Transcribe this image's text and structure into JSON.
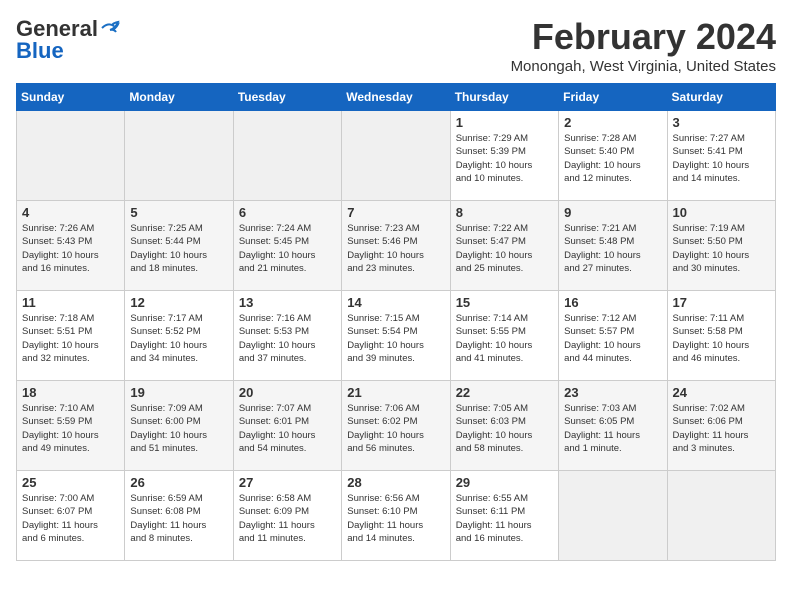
{
  "logo": {
    "name_general": "General",
    "name_blue": "Blue"
  },
  "header": {
    "month_year": "February 2024",
    "location": "Monongah, West Virginia, United States"
  },
  "days_of_week": [
    "Sunday",
    "Monday",
    "Tuesday",
    "Wednesday",
    "Thursday",
    "Friday",
    "Saturday"
  ],
  "weeks": [
    {
      "row_class": "row-white",
      "days": [
        {
          "num": "",
          "empty": true,
          "info": ""
        },
        {
          "num": "",
          "empty": true,
          "info": ""
        },
        {
          "num": "",
          "empty": true,
          "info": ""
        },
        {
          "num": "",
          "empty": true,
          "info": ""
        },
        {
          "num": "1",
          "empty": false,
          "info": "Sunrise: 7:29 AM\nSunset: 5:39 PM\nDaylight: 10 hours\nand 10 minutes."
        },
        {
          "num": "2",
          "empty": false,
          "info": "Sunrise: 7:28 AM\nSunset: 5:40 PM\nDaylight: 10 hours\nand 12 minutes."
        },
        {
          "num": "3",
          "empty": false,
          "info": "Sunrise: 7:27 AM\nSunset: 5:41 PM\nDaylight: 10 hours\nand 14 minutes."
        }
      ]
    },
    {
      "row_class": "row-gray",
      "days": [
        {
          "num": "4",
          "empty": false,
          "info": "Sunrise: 7:26 AM\nSunset: 5:43 PM\nDaylight: 10 hours\nand 16 minutes."
        },
        {
          "num": "5",
          "empty": false,
          "info": "Sunrise: 7:25 AM\nSunset: 5:44 PM\nDaylight: 10 hours\nand 18 minutes."
        },
        {
          "num": "6",
          "empty": false,
          "info": "Sunrise: 7:24 AM\nSunset: 5:45 PM\nDaylight: 10 hours\nand 21 minutes."
        },
        {
          "num": "7",
          "empty": false,
          "info": "Sunrise: 7:23 AM\nSunset: 5:46 PM\nDaylight: 10 hours\nand 23 minutes."
        },
        {
          "num": "8",
          "empty": false,
          "info": "Sunrise: 7:22 AM\nSunset: 5:47 PM\nDaylight: 10 hours\nand 25 minutes."
        },
        {
          "num": "9",
          "empty": false,
          "info": "Sunrise: 7:21 AM\nSunset: 5:48 PM\nDaylight: 10 hours\nand 27 minutes."
        },
        {
          "num": "10",
          "empty": false,
          "info": "Sunrise: 7:19 AM\nSunset: 5:50 PM\nDaylight: 10 hours\nand 30 minutes."
        }
      ]
    },
    {
      "row_class": "row-white",
      "days": [
        {
          "num": "11",
          "empty": false,
          "info": "Sunrise: 7:18 AM\nSunset: 5:51 PM\nDaylight: 10 hours\nand 32 minutes."
        },
        {
          "num": "12",
          "empty": false,
          "info": "Sunrise: 7:17 AM\nSunset: 5:52 PM\nDaylight: 10 hours\nand 34 minutes."
        },
        {
          "num": "13",
          "empty": false,
          "info": "Sunrise: 7:16 AM\nSunset: 5:53 PM\nDaylight: 10 hours\nand 37 minutes."
        },
        {
          "num": "14",
          "empty": false,
          "info": "Sunrise: 7:15 AM\nSunset: 5:54 PM\nDaylight: 10 hours\nand 39 minutes."
        },
        {
          "num": "15",
          "empty": false,
          "info": "Sunrise: 7:14 AM\nSunset: 5:55 PM\nDaylight: 10 hours\nand 41 minutes."
        },
        {
          "num": "16",
          "empty": false,
          "info": "Sunrise: 7:12 AM\nSunset: 5:57 PM\nDaylight: 10 hours\nand 44 minutes."
        },
        {
          "num": "17",
          "empty": false,
          "info": "Sunrise: 7:11 AM\nSunset: 5:58 PM\nDaylight: 10 hours\nand 46 minutes."
        }
      ]
    },
    {
      "row_class": "row-gray",
      "days": [
        {
          "num": "18",
          "empty": false,
          "info": "Sunrise: 7:10 AM\nSunset: 5:59 PM\nDaylight: 10 hours\nand 49 minutes."
        },
        {
          "num": "19",
          "empty": false,
          "info": "Sunrise: 7:09 AM\nSunset: 6:00 PM\nDaylight: 10 hours\nand 51 minutes."
        },
        {
          "num": "20",
          "empty": false,
          "info": "Sunrise: 7:07 AM\nSunset: 6:01 PM\nDaylight: 10 hours\nand 54 minutes."
        },
        {
          "num": "21",
          "empty": false,
          "info": "Sunrise: 7:06 AM\nSunset: 6:02 PM\nDaylight: 10 hours\nand 56 minutes."
        },
        {
          "num": "22",
          "empty": false,
          "info": "Sunrise: 7:05 AM\nSunset: 6:03 PM\nDaylight: 10 hours\nand 58 minutes."
        },
        {
          "num": "23",
          "empty": false,
          "info": "Sunrise: 7:03 AM\nSunset: 6:05 PM\nDaylight: 11 hours\nand 1 minute."
        },
        {
          "num": "24",
          "empty": false,
          "info": "Sunrise: 7:02 AM\nSunset: 6:06 PM\nDaylight: 11 hours\nand 3 minutes."
        }
      ]
    },
    {
      "row_class": "row-white",
      "days": [
        {
          "num": "25",
          "empty": false,
          "info": "Sunrise: 7:00 AM\nSunset: 6:07 PM\nDaylight: 11 hours\nand 6 minutes."
        },
        {
          "num": "26",
          "empty": false,
          "info": "Sunrise: 6:59 AM\nSunset: 6:08 PM\nDaylight: 11 hours\nand 8 minutes."
        },
        {
          "num": "27",
          "empty": false,
          "info": "Sunrise: 6:58 AM\nSunset: 6:09 PM\nDaylight: 11 hours\nand 11 minutes."
        },
        {
          "num": "28",
          "empty": false,
          "info": "Sunrise: 6:56 AM\nSunset: 6:10 PM\nDaylight: 11 hours\nand 14 minutes."
        },
        {
          "num": "29",
          "empty": false,
          "info": "Sunrise: 6:55 AM\nSunset: 6:11 PM\nDaylight: 11 hours\nand 16 minutes."
        },
        {
          "num": "",
          "empty": true,
          "info": ""
        },
        {
          "num": "",
          "empty": true,
          "info": ""
        }
      ]
    }
  ]
}
